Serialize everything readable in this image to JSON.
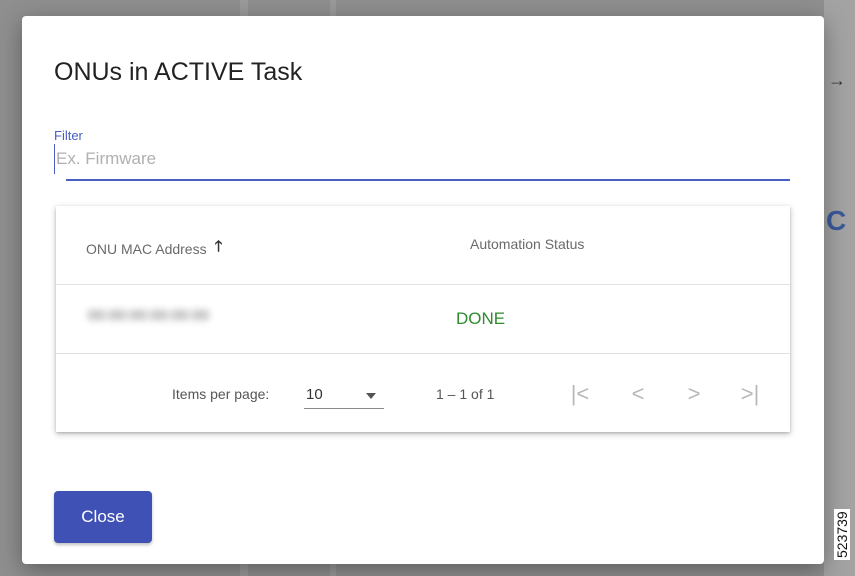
{
  "dialog": {
    "title": "ONUs in ACTIVE Task",
    "filter": {
      "label": "Filter",
      "placeholder": "Ex. Firmware",
      "value": ""
    },
    "table": {
      "columns": [
        "ONU MAC Address",
        "Automation Status"
      ],
      "sort": {
        "column": "ONU MAC Address",
        "direction": "ascending",
        "icon": "arrow-up-icon"
      },
      "rows": [
        {
          "mac": "00:00:00:00:00:00",
          "status": "DONE"
        }
      ],
      "paginator": {
        "items_per_page_label": "Items per page:",
        "items_per_page_value": "10",
        "range_label": "1 – 1 of 1",
        "nav_icons": {
          "first": "|<",
          "prev": "<",
          "next": ">",
          "last": ">|"
        }
      }
    },
    "close_label": "Close"
  },
  "figure_id": "523739",
  "colors": {
    "primary": "#3f51b5",
    "status_done": "#2e8b2e",
    "overlay": "#8f8f8f"
  }
}
